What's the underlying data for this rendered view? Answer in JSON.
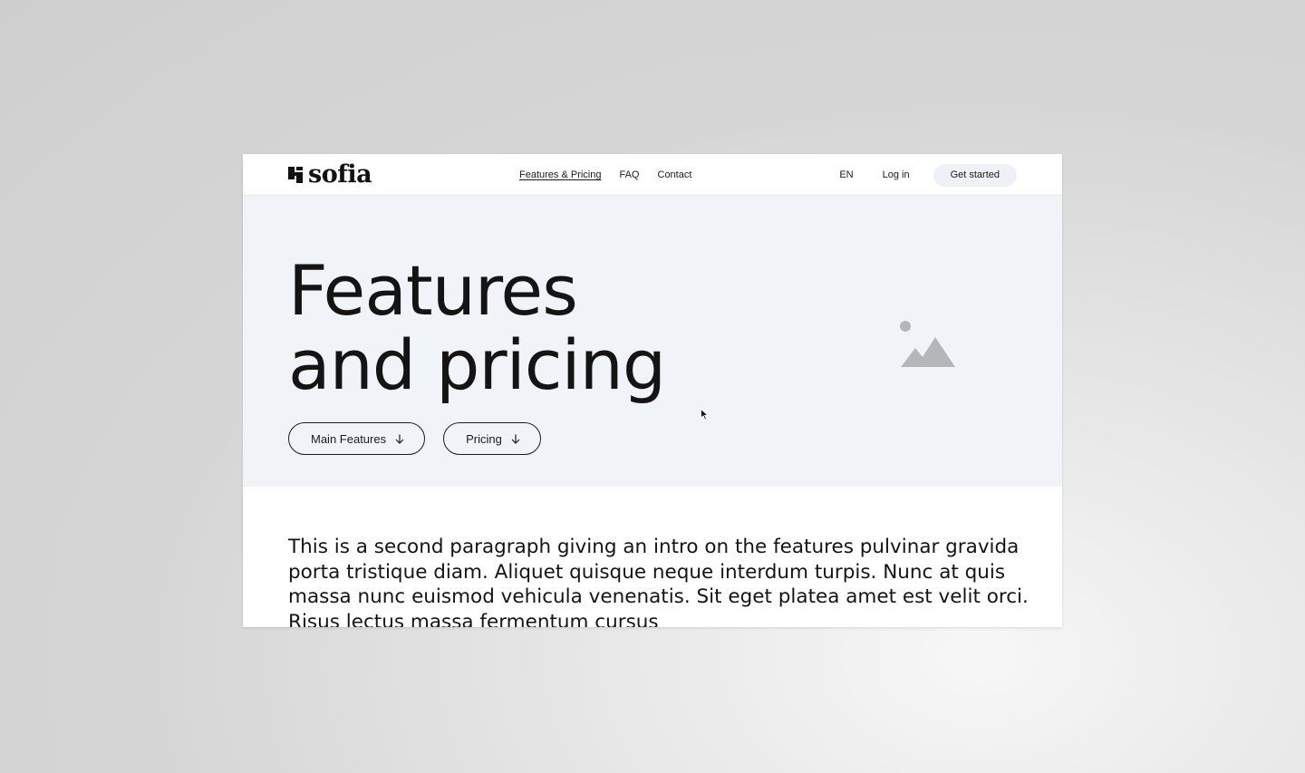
{
  "logo": {
    "text": "sofia"
  },
  "nav": {
    "links": [
      {
        "label": "Features & Pricing"
      },
      {
        "label": "FAQ"
      },
      {
        "label": "Contact"
      }
    ],
    "language": "EN",
    "login": "Log in",
    "cta": "Get started"
  },
  "hero": {
    "title_line1": "Features",
    "title_line2": "and pricing",
    "buttons": [
      {
        "label": "Main Features",
        "icon": "arrow-down-icon"
      },
      {
        "label": "Pricing",
        "icon": "arrow-down-icon"
      }
    ],
    "image_icon": "image-placeholder-icon"
  },
  "intro": {
    "text": "This is a second paragraph giving an intro on the features pulvinar gravida porta tristique diam. Aliquet quisque neque interdum turpis. Nunc at quis massa nunc euismod vehicula venenatis. Sit eget platea amet est velit orci. Risus lectus massa fermentum cursus"
  },
  "colors": {
    "hero_background": "#f0f3f7",
    "cta_background": "#eef1f5",
    "text": "#141414",
    "placeholder_icon": "#b4b6b9"
  }
}
